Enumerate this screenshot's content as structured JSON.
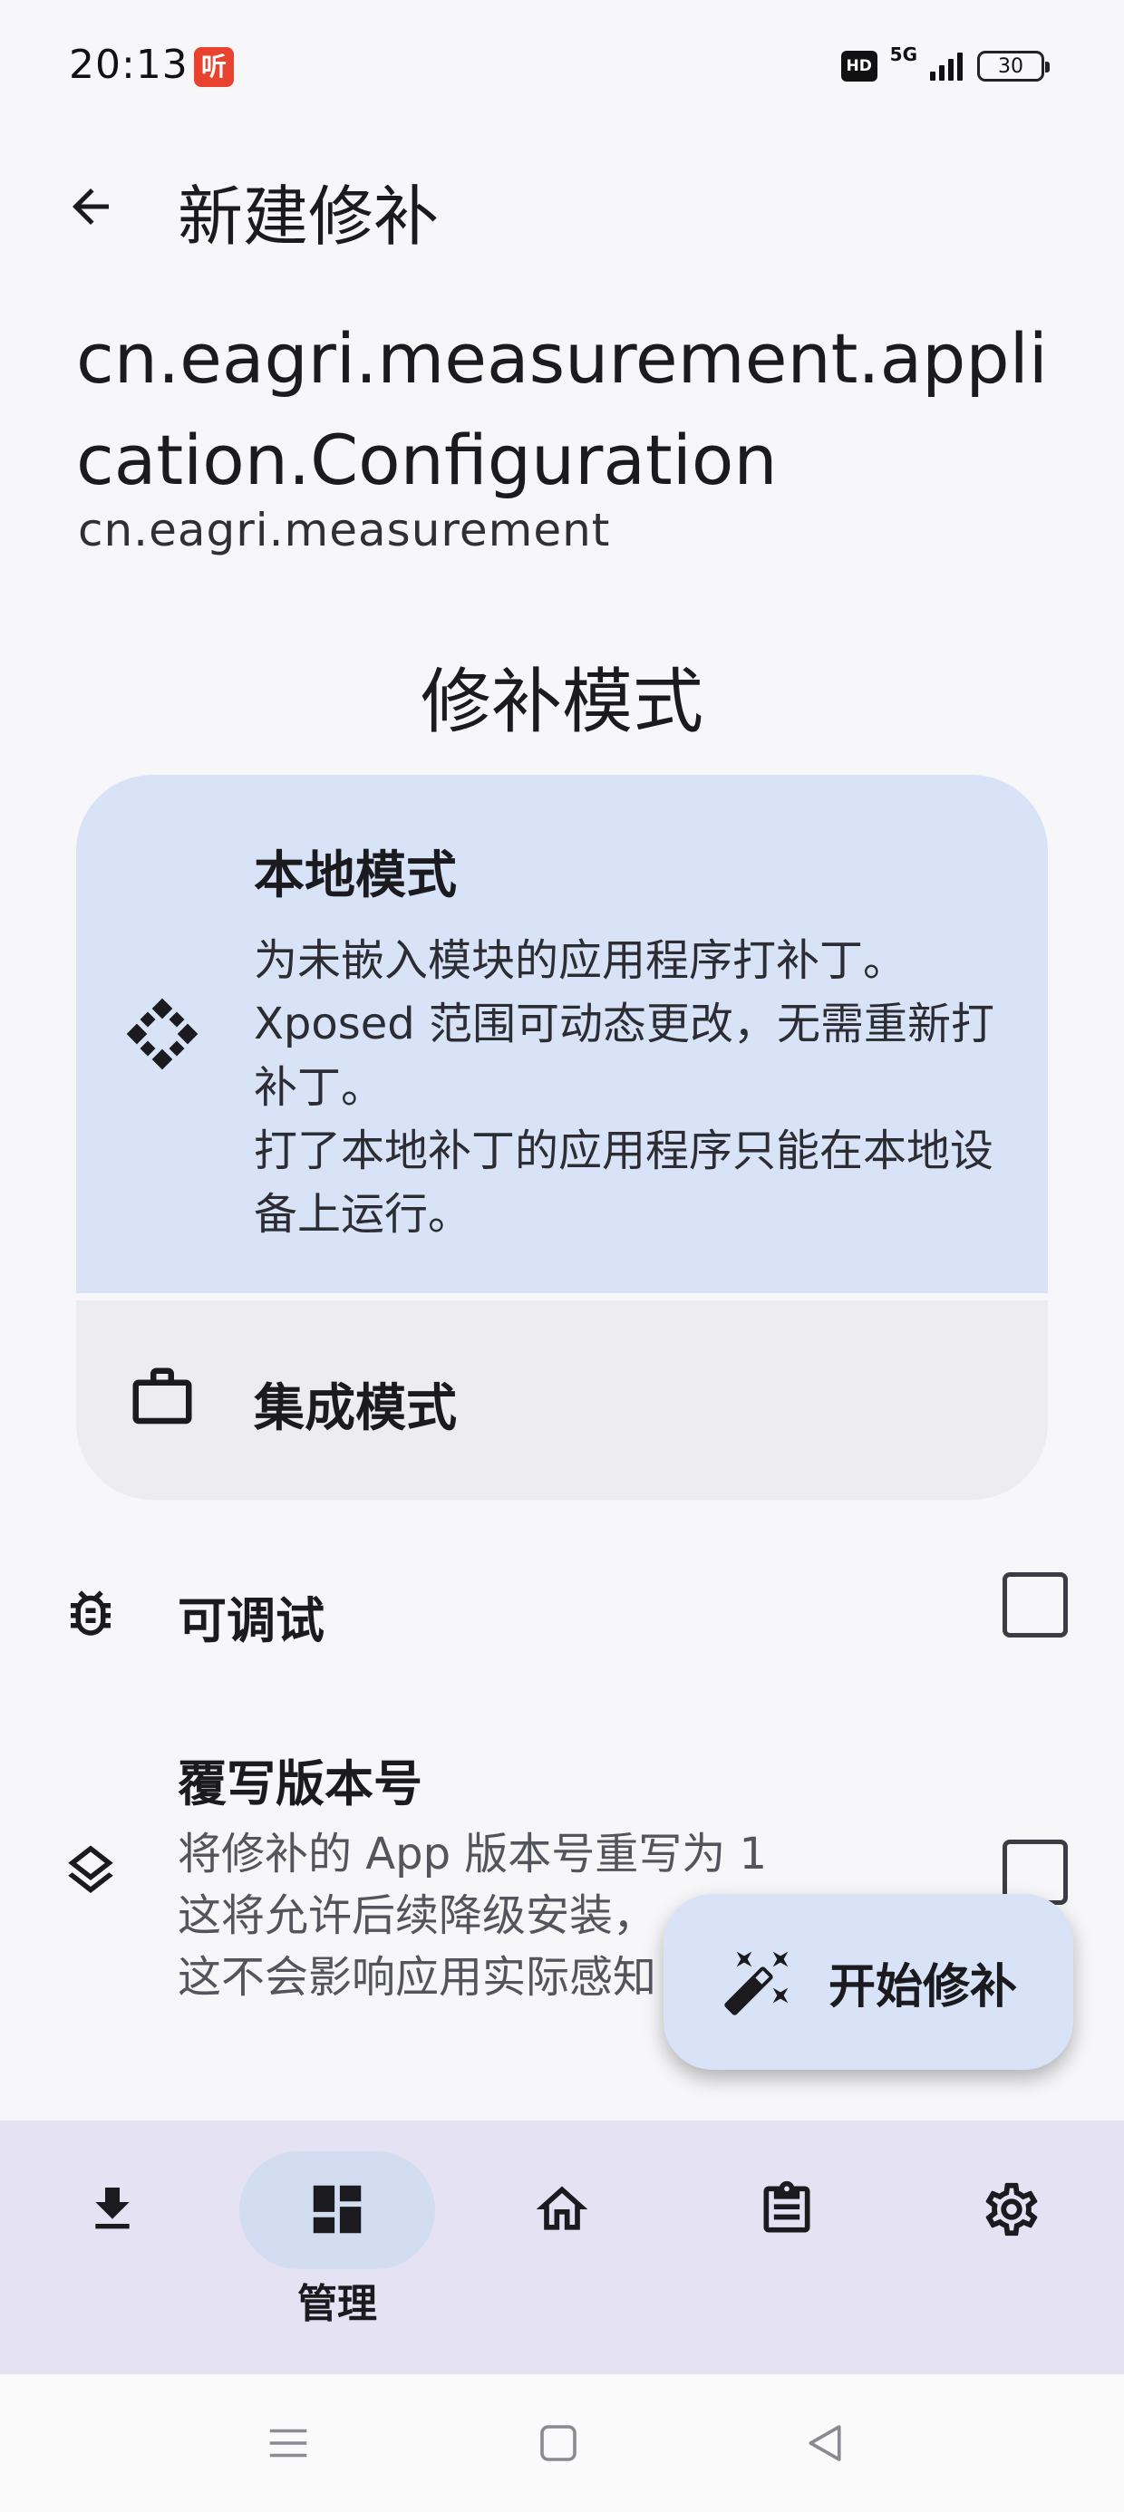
{
  "status_bar": {
    "time": "20:13",
    "notification_app_glyph": "听",
    "hd_badge": "HD",
    "network_type": "5G",
    "battery_level": "30"
  },
  "header": {
    "title": "新建修补",
    "back_icon": "arrow-back-icon"
  },
  "app_info": {
    "name": "cn.eagri.measurement.application.Configuration",
    "package": "cn.eagri.measurement"
  },
  "patch_mode": {
    "section_title": "修补模式",
    "modes": [
      {
        "title": "本地模式",
        "icon": "xposed-diamond-icon",
        "selected": true,
        "description": [
          "为未嵌入模块的应用程序打补丁。",
          "Xposed 范围可动态更改，无需重新打补丁。",
          "打了本地补丁的应用程序只能在本地设备上运行。"
        ]
      },
      {
        "title": "集成模式",
        "icon": "briefcase-icon",
        "selected": false
      }
    ]
  },
  "options": [
    {
      "title": "可调试",
      "icon": "bug-icon",
      "checked": false
    },
    {
      "title": "覆写版本号",
      "icon": "layers-icon",
      "checked": false,
      "description": [
        "将修补的 App 版本号重写为 1",
        "这将允许后续降级安装，",
        "这不会影响应用实际感知"
      ]
    }
  ],
  "fab": {
    "label": "开始修补",
    "icon": "magic-wand-icon"
  },
  "bottom_nav": {
    "items": [
      {
        "icon": "download-icon",
        "label": "",
        "active": false
      },
      {
        "icon": "dashboard-icon",
        "label": "管理",
        "active": true
      },
      {
        "icon": "home-icon",
        "label": "",
        "active": false
      },
      {
        "icon": "clipboard-list-icon",
        "label": "",
        "active": false
      },
      {
        "icon": "settings-gear-icon",
        "label": "",
        "active": false
      }
    ]
  },
  "colors": {
    "background": "#f7f7fa",
    "selected_card": "#d8e3f8",
    "unselected_card": "#ededf0",
    "bottom_nav": "#e4e2f3",
    "active_pill": "#d2ddf1",
    "fab": "#d8e3f8"
  }
}
